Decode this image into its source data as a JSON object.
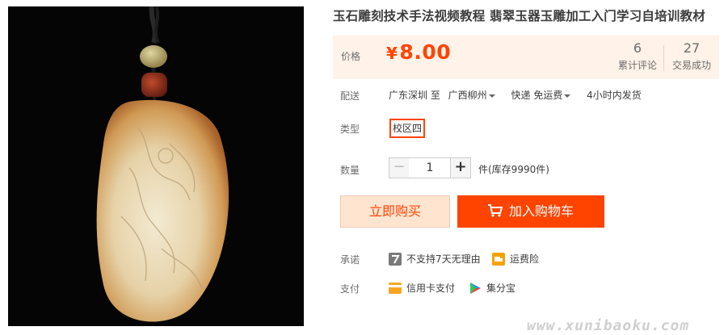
{
  "product": {
    "image_alt": "jade pendant carving",
    "title": "玉石雕刻技术手法视频教程 翡翠玉器玉雕加工入门学习自培训教材"
  },
  "price": {
    "label": "价格",
    "currency": "¥",
    "value": "8.00",
    "color": "#ff4400"
  },
  "stats": {
    "reviews_count": "6",
    "reviews_label": "累计评论",
    "trades_count": "27",
    "trades_label": "交易成功"
  },
  "shipping": {
    "label": "配送",
    "from": "广东深圳 至",
    "to": "广西柳州",
    "method": "快递 免运费",
    "dispatch": "4小时内发货"
  },
  "sku": {
    "label": "类型",
    "selected": "校区四"
  },
  "quantity": {
    "label": "数量",
    "value": "1",
    "minus": "−",
    "plus": "+",
    "stock": "件(库存9990件)"
  },
  "actions": {
    "buy_now": "立即购买",
    "add_to_cart": "加入购物车"
  },
  "promise": {
    "label": "承诺",
    "items": [
      "不支持7天无理由",
      "运费险"
    ]
  },
  "payment": {
    "label": "支付",
    "items": [
      "信用卡支付",
      "集分宝"
    ]
  },
  "watermark": "www.xunibaoku.com"
}
